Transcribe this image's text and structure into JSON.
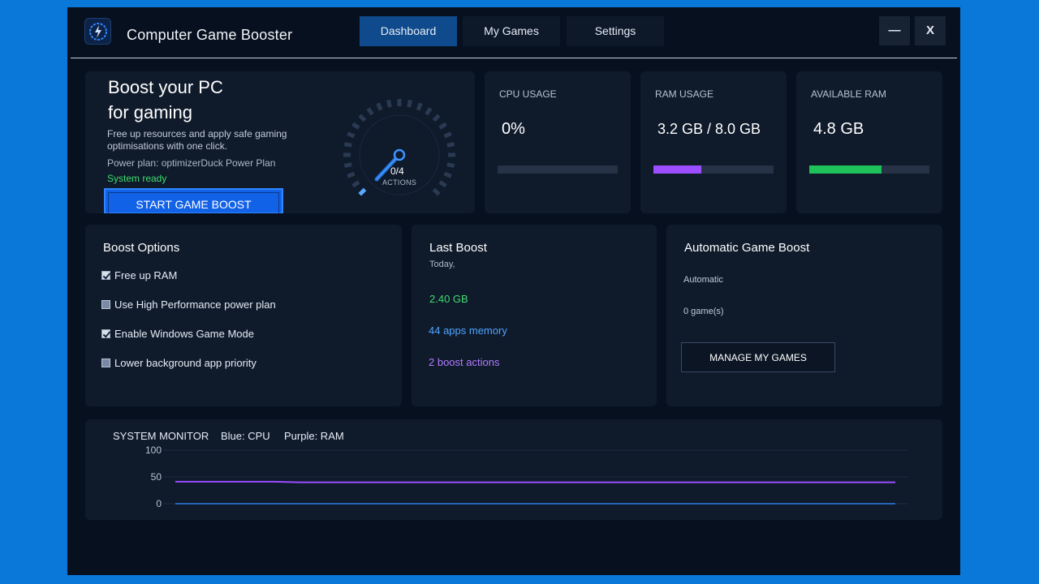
{
  "app": {
    "title": "Computer Game Booster"
  },
  "tabs": [
    {
      "label": "Dashboard",
      "active": true
    },
    {
      "label": "My Games",
      "active": false
    },
    {
      "label": "Settings",
      "active": false
    }
  ],
  "window_controls": {
    "minimize": "—",
    "close": "X"
  },
  "hero": {
    "title_line1": "Boost your PC",
    "title_line2": "for gaming",
    "description": "Free up resources and apply safe gaming optimisations with one click.",
    "power_plan": "Power plan: optimizerDuck Power Plan",
    "status": "System ready",
    "button_label": "START GAME BOOST",
    "gauge_count": "0/4",
    "gauge_label": "ACTIONS"
  },
  "stats": {
    "cpu": {
      "label": "CPU USAGE",
      "value": "0%",
      "fraction": 0.0,
      "color": "#3b8cf0"
    },
    "ram": {
      "label": "RAM USAGE",
      "value": "3.2 GB / 8.0 GB",
      "fraction": 0.4,
      "color": "#9b4dff"
    },
    "available": {
      "label": "AVAILABLE RAM",
      "value": "4.8 GB",
      "fraction": 0.6,
      "color": "#1fc25a"
    }
  },
  "boost_options": {
    "title": "Boost Options",
    "items": [
      {
        "label": "Free up RAM",
        "checked": true
      },
      {
        "label": "Use High Performance power plan",
        "checked": false
      },
      {
        "label": "Enable Windows Game Mode",
        "checked": true
      },
      {
        "label": "Lower background app priority",
        "checked": false
      }
    ]
  },
  "last_boost": {
    "title": "Last Boost",
    "date": "Today,",
    "freed": "2.40 GB",
    "apps": "44 apps memory",
    "actions": "2 boost actions"
  },
  "auto_boost": {
    "title": "Automatic Game Boost",
    "mode": "Automatic",
    "count": "0 game(s)",
    "button_label": "MANAGE MY GAMES"
  },
  "monitor": {
    "title": "SYSTEM MONITOR",
    "cpu_legend": "Blue: CPU",
    "ram_legend": "Purple: RAM",
    "y_ticks": [
      "100",
      "50",
      "0"
    ],
    "ylim": [
      0,
      100
    ],
    "cpu_color": "#2f7de8",
    "ram_color": "#9b4dff",
    "cpu_values": [
      0,
      0,
      0,
      0,
      0,
      0,
      0,
      0,
      0,
      0,
      0,
      0,
      0,
      0,
      0,
      0,
      0,
      0,
      0,
      0,
      0,
      0,
      0,
      0,
      0,
      0,
      0,
      0,
      0,
      0
    ],
    "ram_values": [
      41,
      41,
      41,
      41,
      41,
      40,
      40,
      40,
      40,
      40,
      40,
      40,
      40,
      40,
      40,
      40,
      40,
      40,
      40,
      40,
      40,
      40,
      40,
      40,
      40,
      40,
      40,
      40,
      40,
      40
    ]
  }
}
